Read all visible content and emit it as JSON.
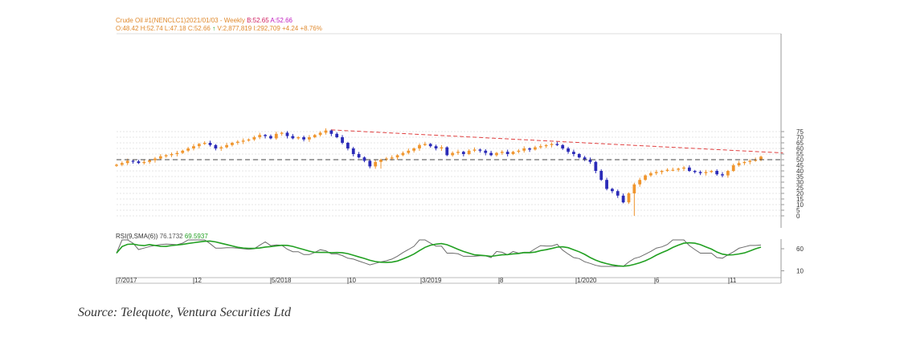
{
  "header": {
    "instrument": "Crude Oil #1(NENCLC1)2021/01/03",
    "period": "- Weekly",
    "bid": "B:52.65",
    "ask": "A:52.66",
    "ohlc": "O:48.42 H:52.74 L:47.18 C:52.66",
    "arrow": "↑",
    "stats": "V:2,877,819 I:292,709  +4.24  +8.76%"
  },
  "rsi": {
    "label": "RSI(9,SMA(6))",
    "value1": "76.1732",
    "value2": "69.5937",
    "ticks": [
      "60",
      "10"
    ]
  },
  "x_axis": {
    "labels": [
      "7/2017",
      "12",
      "5/2018",
      "10",
      "3/2019",
      "8",
      "1/2020",
      "6",
      "11"
    ]
  },
  "source": "Source: Telequote, Ventura Securities Ltd",
  "colors": {
    "up": "#f0962e",
    "down": "#2b2bb8",
    "trendline": "#e04040",
    "support": "#444444",
    "rsi_line": "#6b6b6b",
    "rsi_sma": "#22a022"
  },
  "chart_data": {
    "type": "candlestick",
    "y_ticks": [
      0,
      5,
      10,
      15,
      20,
      25,
      30,
      35,
      40,
      45,
      50,
      55,
      60,
      65,
      70,
      75
    ],
    "ylim": [
      0,
      77
    ],
    "support_level": 50,
    "close": [
      45.5,
      47,
      49,
      48.5,
      47,
      48,
      49.5,
      51,
      53,
      54,
      55,
      56,
      58,
      60,
      62,
      64,
      65,
      63,
      60,
      61,
      63,
      65,
      66,
      67,
      68,
      70,
      72,
      71,
      69,
      73,
      74,
      71,
      69,
      70,
      68,
      70,
      72,
      74,
      76,
      73,
      70,
      65,
      60,
      55,
      52,
      49,
      44,
      48,
      50,
      51,
      52,
      54,
      56,
      58,
      60,
      63,
      64,
      62,
      60,
      61,
      54,
      56,
      57,
      55,
      58,
      59,
      58,
      56,
      54,
      56,
      57,
      55,
      57,
      58,
      60,
      59,
      61,
      62,
      63,
      64,
      63,
      60,
      57,
      55,
      52,
      50,
      48,
      40,
      32,
      24,
      22,
      18,
      12,
      20,
      28,
      32,
      36,
      38,
      39,
      40,
      41,
      41,
      42,
      43,
      40,
      39,
      38,
      39,
      40,
      37,
      36,
      40,
      45,
      47,
      48,
      49,
      50,
      52.66
    ],
    "low_spikes": [
      {
        "x": 94,
        "low": 0
      },
      {
        "x": 48,
        "low": 42
      }
    ],
    "trendline": {
      "from": {
        "x": 39,
        "y": 76.5
      },
      "to": {
        "x": 121,
        "y": 56
      }
    },
    "x_labels": [
      "7/2017",
      "12",
      "5/2018",
      "10",
      "3/2019",
      "8",
      "1/2020",
      "6",
      "11"
    ]
  }
}
